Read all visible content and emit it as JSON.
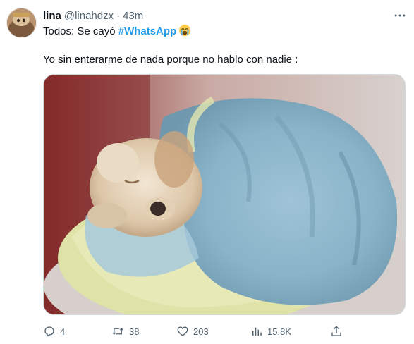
{
  "tweet": {
    "author": {
      "display_name": "lina",
      "handle": "@linahdzx",
      "separator": "·",
      "time": "43m"
    },
    "text_line1_prefix": "Todos: Se cayó ",
    "hashtag": "#WhatsApp",
    "emoji": "crying-face-emoji",
    "text_line2": "Yo sin enterarme de nada porque no hablo con nadie :",
    "media": {
      "kind": "photo",
      "description_icon": "sleeping-puppy-in-blanket-image"
    },
    "actions": {
      "replies": "4",
      "retweets": "38",
      "likes": "203",
      "views": "15.8K"
    }
  },
  "colors": {
    "text": "#0f1419",
    "secondary": "#536471",
    "link": "#1d9bf0",
    "border": "#cfd9de"
  }
}
